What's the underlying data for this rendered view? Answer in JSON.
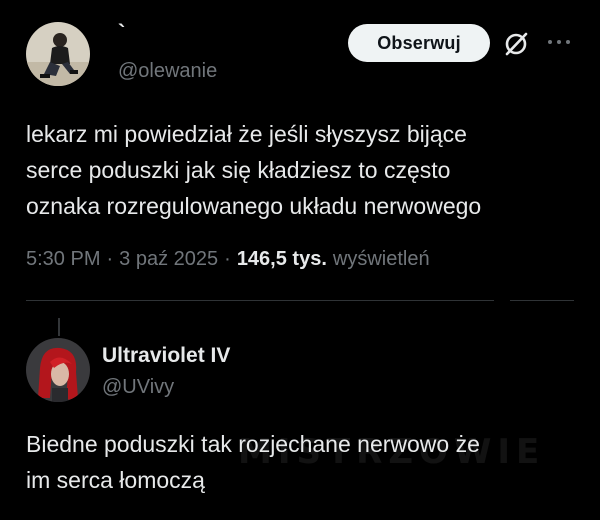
{
  "post": {
    "display_name": "`",
    "handle": "@olewanie",
    "follow_label": "Obserwuj",
    "lines": [
      "lekarz mi powiedział że jeśli słyszysz bijące",
      "serce poduszki jak się kładziesz to często",
      "oznaka rozregulowanego układu nerwowego"
    ],
    "time": "5:30 PM",
    "separator": "·",
    "date": "3 paź 2025",
    "views": "146,5 tys.",
    "views_label": "wyświetleń"
  },
  "reply": {
    "display_name": "Ultraviolet IV",
    "handle": "@UVivy",
    "lines": [
      "Biedne poduszki tak rozjechane nerwowo że",
      "im serca łomoczą"
    ]
  },
  "watermark": "MISTRZOWIE",
  "icons": {
    "avatar_1": "avatar-photo-person-sitting",
    "avatar_2": "avatar-photo-red-hair",
    "grok": "grok-icon",
    "more": "more-icon"
  },
  "colors": {
    "background": "#000000",
    "text_primary": "#e7e9ea",
    "text_secondary": "#71767b",
    "button_bg": "#eff3f4",
    "divider": "#2f3336"
  }
}
